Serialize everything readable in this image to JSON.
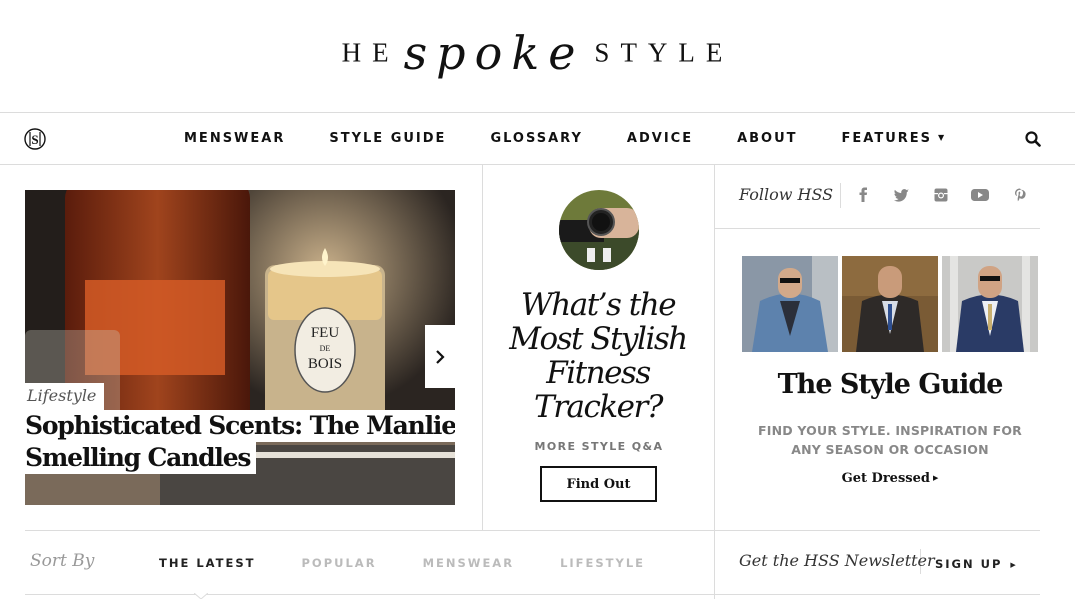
{
  "logo": {
    "left_caps": "HE",
    "script": "spoke",
    "right_caps": "STYLE"
  },
  "nav": {
    "items": [
      {
        "label": "MENSWEAR"
      },
      {
        "label": "STYLE GUIDE"
      },
      {
        "label": "GLOSSARY"
      },
      {
        "label": "ADVICE"
      },
      {
        "label": "ABOUT"
      },
      {
        "label": "FEATURES",
        "has_dropdown": true
      }
    ],
    "caret": "▼",
    "icons": {
      "monogram": "hss-monogram-icon",
      "search": "search-icon"
    }
  },
  "hero": {
    "category": "Lifestyle",
    "title_line1": "Sophisticated Scents: The Manliest",
    "title_line2": "Smelling Candles",
    "candle_label": [
      "FEU",
      "DE",
      "BOIS"
    ],
    "next_icon": "chevron-right-icon"
  },
  "qa": {
    "title_lines": [
      "What’s the",
      "Most Stylish",
      "Fitness",
      "Tracker?"
    ],
    "subtitle": "MORE STYLE Q&A",
    "button_label": "Find Out"
  },
  "follow": {
    "label": "Follow HSS",
    "icons": [
      "facebook-icon",
      "twitter-icon",
      "instagram-icon",
      "youtube-icon",
      "pinterest-icon"
    ]
  },
  "style_guide": {
    "title": "The Style Guide",
    "subtitle": "FIND YOUR STYLE. INSPIRATION FOR ANY SEASON OR OCCASION",
    "link_label": "Get Dressed",
    "link_arrow": "▶"
  },
  "sort": {
    "label": "Sort By",
    "tabs": [
      {
        "label": "THE LATEST",
        "active": true
      },
      {
        "label": "POPULAR",
        "active": false
      },
      {
        "label": "MENSWEAR",
        "active": false
      },
      {
        "label": "LIFESTYLE",
        "active": false
      }
    ]
  },
  "newsletter": {
    "label": "Get the HSS Newsletter",
    "signup_label": "SIGN UP",
    "arrow": "▶"
  }
}
